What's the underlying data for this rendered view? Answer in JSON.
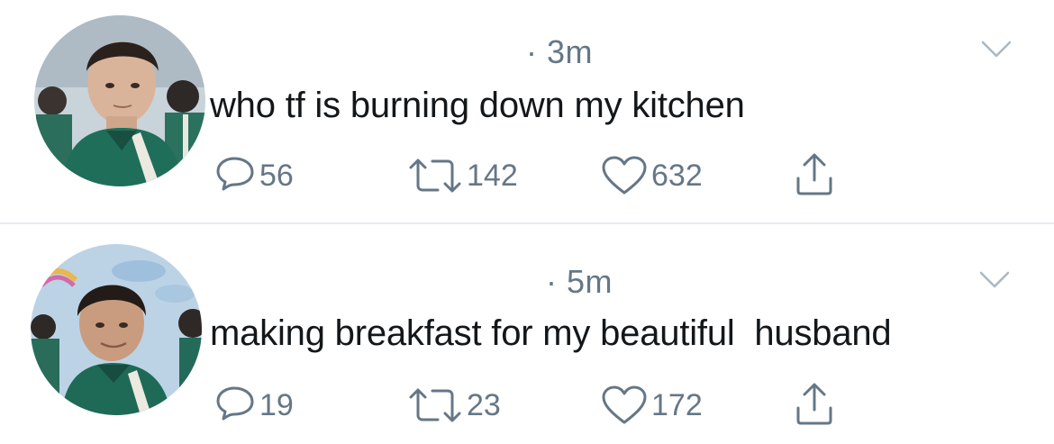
{
  "tweets": [
    {
      "timestamp": "· 3m",
      "text": "who tf is burning down my kitchen",
      "replies": "56",
      "retweets": "142",
      "likes": "632"
    },
    {
      "timestamp": "· 5m",
      "text": "making breakfast for my beautiful  husband",
      "replies": "19",
      "retweets": "23",
      "likes": "172"
    }
  ],
  "colors": {
    "icon_gray": "#657786",
    "text": "#14171a",
    "divider": "#e6ecf0",
    "tracksuit_green": "#1f6e5a"
  },
  "icons": {
    "reply": "reply-icon",
    "retweet": "retweet-icon",
    "like": "heart-icon",
    "share": "share-icon",
    "more": "chevron-down-icon"
  }
}
